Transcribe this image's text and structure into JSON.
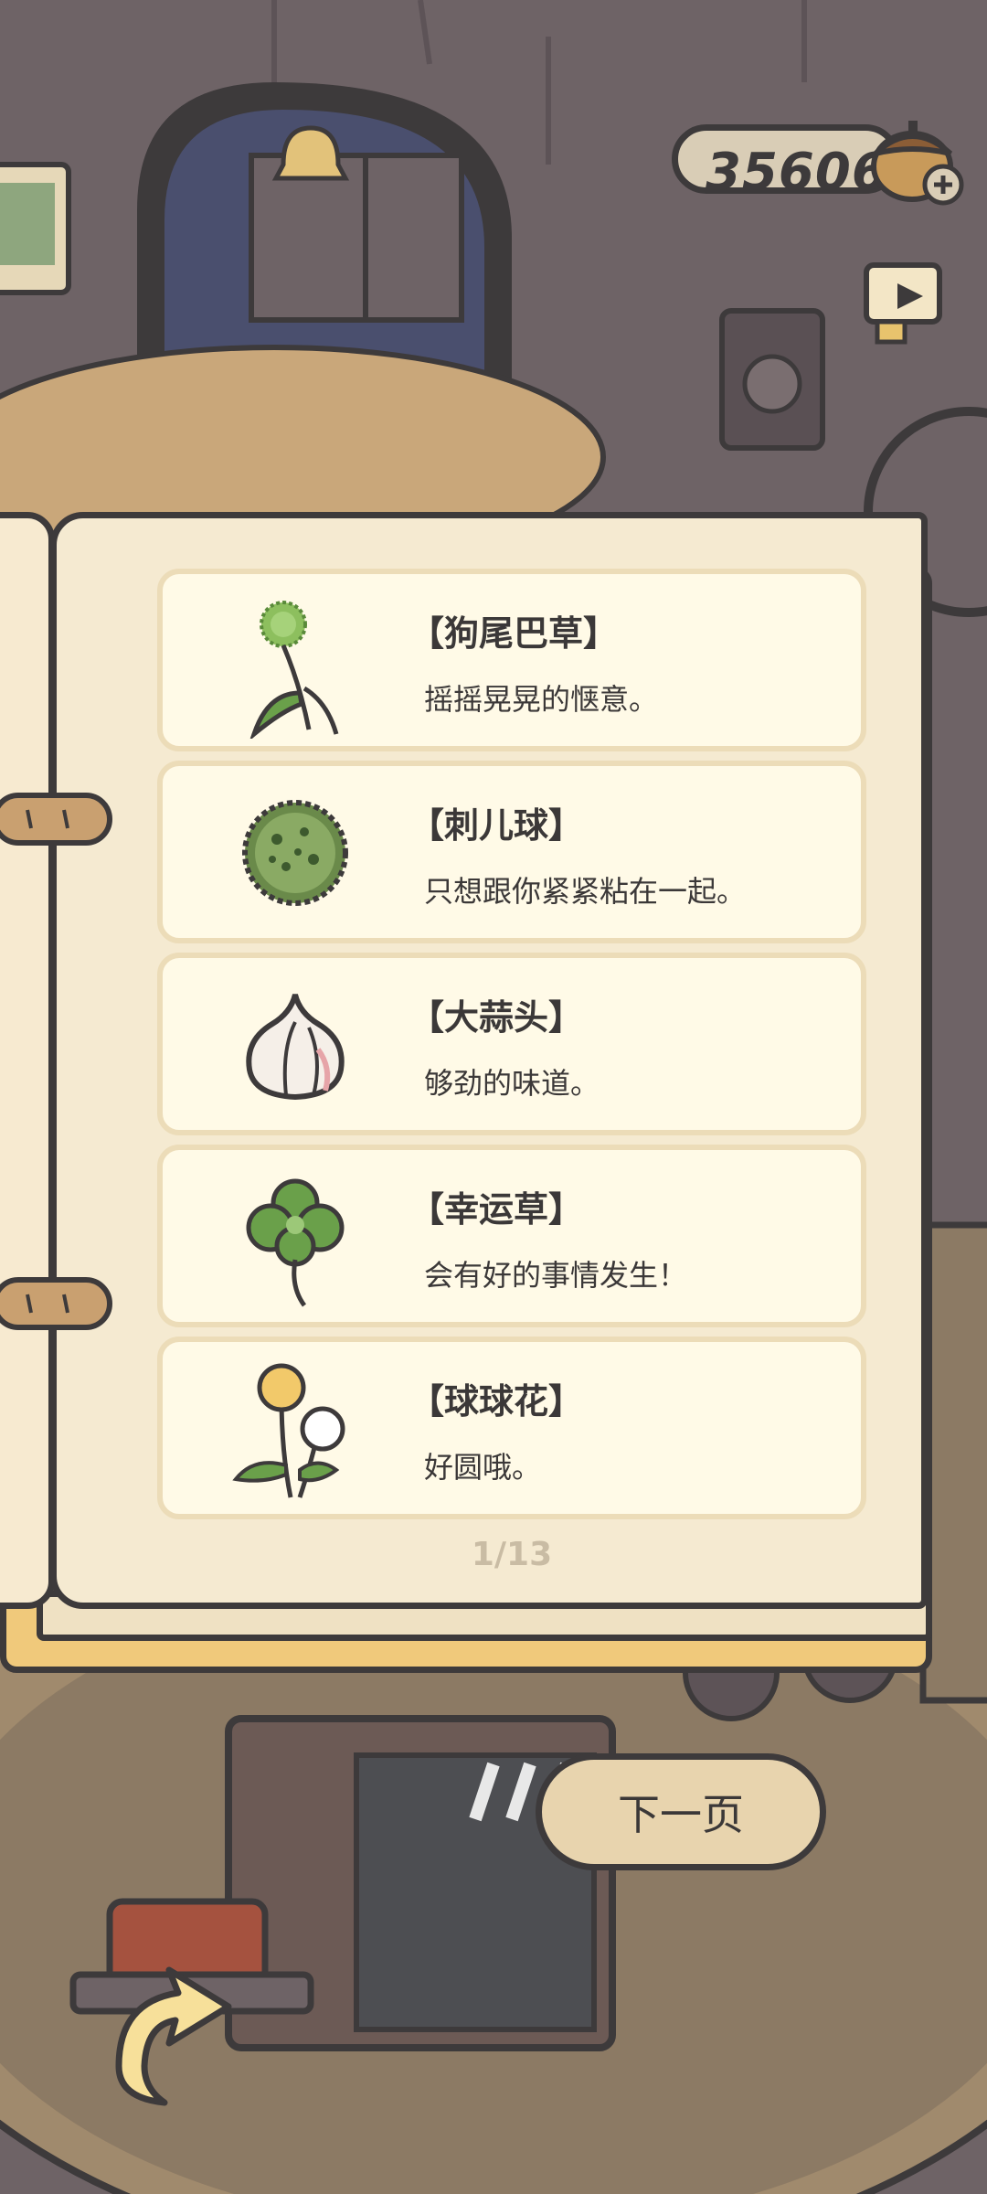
{
  "currency": {
    "value": "35606",
    "icon": "acorn-plus-icon"
  },
  "toolbar": {
    "video_icon": "video-camera-icon"
  },
  "items": [
    {
      "title": "【狗尾巴草】",
      "desc": "摇摇晃晃的惬意。",
      "icon": "foxtail-grass-icon"
    },
    {
      "title": "【刺儿球】",
      "desc": "只想跟你紧紧粘在一起。",
      "icon": "burr-ball-icon"
    },
    {
      "title": "【大蒜头】",
      "desc": "够劲的味道。",
      "icon": "garlic-icon"
    },
    {
      "title": "【幸运草】",
      "desc": "会有好的事情发生！",
      "icon": "clover-icon"
    },
    {
      "title": "【球球花】",
      "desc": "好圆哦。",
      "icon": "ball-flower-icon"
    }
  ],
  "pagination": {
    "label": "1/13"
  },
  "next_button": {
    "label": "下一页"
  },
  "back_button": {
    "icon": "back-arrow-icon"
  },
  "colors": {
    "page": "#f5ead1",
    "card": "#fffae7",
    "outline": "#3d3a3b",
    "button": "#e8d4ae"
  }
}
